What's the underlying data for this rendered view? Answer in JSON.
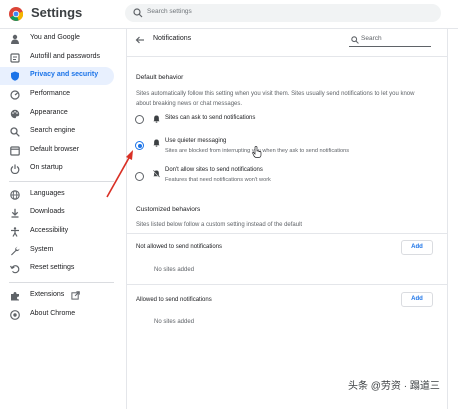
{
  "header": {
    "title": "Settings",
    "search_placeholder": "Search settings",
    "logo_icon": "chrome-logo-icon"
  },
  "sidebar": {
    "items": [
      {
        "label": "You and Google",
        "icon": "person-icon"
      },
      {
        "label": "Autofill and passwords",
        "icon": "autofill-icon"
      },
      {
        "label": "Privacy and security",
        "icon": "shield-icon",
        "active": true
      },
      {
        "label": "Performance",
        "icon": "gauge-icon"
      },
      {
        "label": "Appearance",
        "icon": "palette-icon"
      },
      {
        "label": "Search engine",
        "icon": "search-icon"
      },
      {
        "label": "Default browser",
        "icon": "browser-icon"
      },
      {
        "label": "On startup",
        "icon": "power-icon"
      },
      {
        "label": "Languages",
        "icon": "globe-icon"
      },
      {
        "label": "Downloads",
        "icon": "download-icon"
      },
      {
        "label": "Accessibility",
        "icon": "accessibility-icon"
      },
      {
        "label": "System",
        "icon": "wrench-icon"
      },
      {
        "label": "Reset settings",
        "icon": "reset-icon"
      },
      {
        "label": "Extensions",
        "icon": "puzzle-icon"
      },
      {
        "label": "About Chrome",
        "icon": "chrome-logo-icon"
      }
    ],
    "accent": "#1a73e8"
  },
  "panel": {
    "title": "Notifications",
    "search_placeholder": "Search",
    "default_behavior": {
      "heading": "Default behavior",
      "description_line1": "Sites automatically follow this setting when you visit them. Sites usually send notifications to let you know",
      "description_line2": "about breaking news or chat messages.",
      "options": [
        {
          "label": "Sites can ask to send notifications",
          "sub": "",
          "checked": false,
          "icon": "bell-icon"
        },
        {
          "label": "Use quieter messaging",
          "sub": "Sites are blocked from interrupting you when they ask to send notifications",
          "checked": true,
          "icon": "bell-quiet-icon"
        },
        {
          "label": "Don't allow sites to send notifications",
          "sub": "Features that need notifications won't work",
          "checked": false,
          "icon": "bell-off-icon"
        }
      ]
    },
    "customized": {
      "heading": "Customized behaviors",
      "description": "Sites listed below follow a custom setting instead of the default",
      "not_allowed_label": "Not allowed to send notifications",
      "not_allowed_empty": "No sites added",
      "allowed_label": "Allowed to send notifications",
      "allowed_empty": "No sites added",
      "add_label": "Add"
    }
  },
  "watermark": "头条 @劳资 · 蹋道三"
}
